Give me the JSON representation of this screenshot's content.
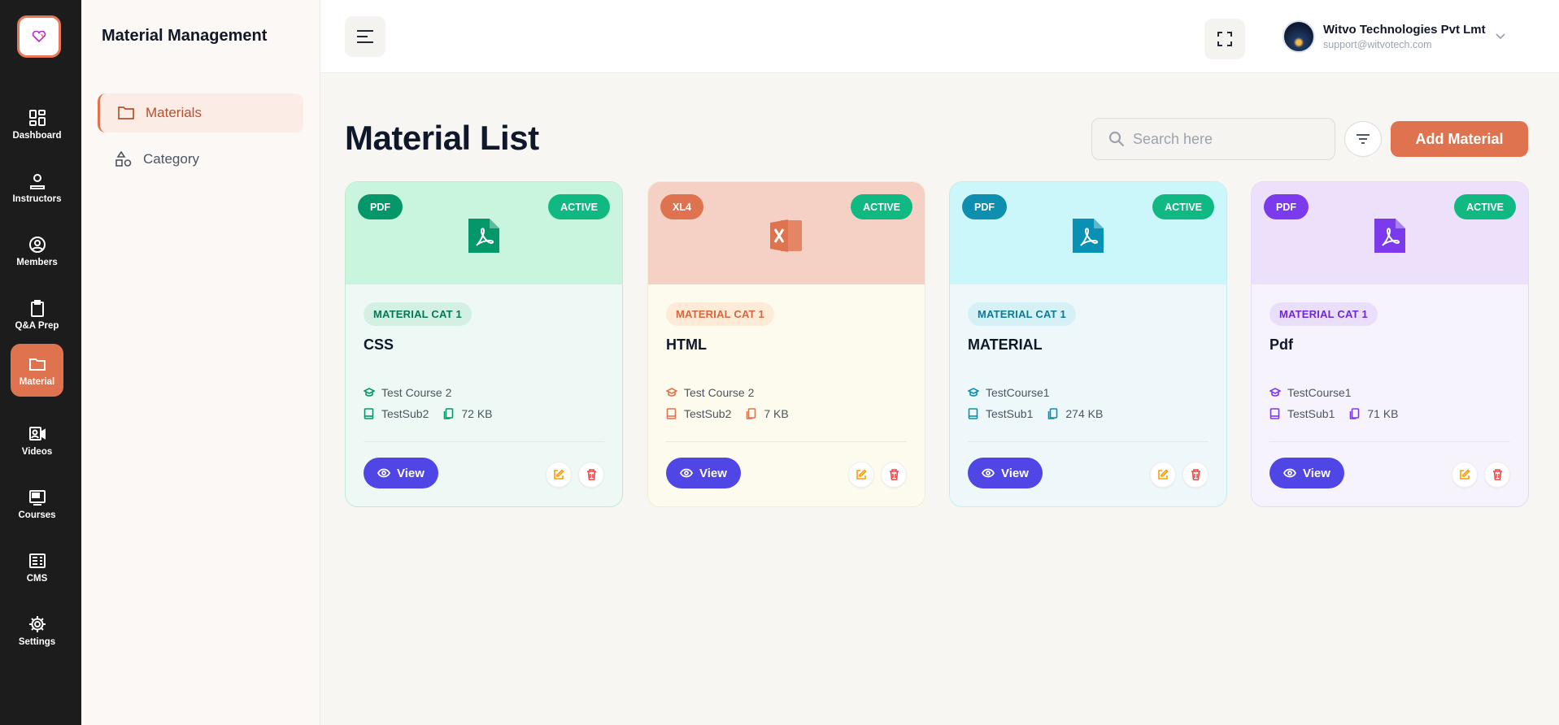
{
  "app": {
    "title": "Material Management"
  },
  "rail": [
    {
      "label": "Dashboard",
      "icon": "dashboard-icon",
      "active": false
    },
    {
      "label": "Instructors",
      "icon": "instructor-icon",
      "active": false
    },
    {
      "label": "Members",
      "icon": "members-icon",
      "active": false
    },
    {
      "label": "Q&A Prep",
      "icon": "clipboard-icon",
      "active": false
    },
    {
      "label": "Material",
      "icon": "folder-icon",
      "active": true
    },
    {
      "label": "Videos",
      "icon": "video-icon",
      "active": false
    },
    {
      "label": "Courses",
      "icon": "courses-icon",
      "active": false
    },
    {
      "label": "CMS",
      "icon": "cms-icon",
      "active": false
    },
    {
      "label": "Settings",
      "icon": "gear-icon",
      "active": false
    }
  ],
  "sidebar": {
    "items": [
      {
        "label": "Materials",
        "icon": "folder-icon",
        "active": true
      },
      {
        "label": "Category",
        "icon": "shapes-icon",
        "active": false
      }
    ]
  },
  "header": {
    "user_name": "Witvo Technologies Pvt Lmt",
    "user_email": "support@witvotech.com"
  },
  "main": {
    "title": "Material List",
    "search_placeholder": "Search here",
    "add_label": "Add Material"
  },
  "cards": [
    {
      "type": "PDF",
      "status": "ACTIVE",
      "category": "MATERIAL CAT 1",
      "title": "CSS",
      "course": "Test Course 2",
      "subject": "TestSub2",
      "size": "72 KB",
      "view_label": "View",
      "theme": {
        "head": "#c9f5df",
        "body": "#eef9f5",
        "border": "#bfe9d5",
        "accent": "#059669",
        "badge": "#059669",
        "cat_bg": "#d3f0e3",
        "cat_text": "#047857"
      }
    },
    {
      "type": "XL4",
      "status": "ACTIVE",
      "category": "MATERIAL CAT 1",
      "title": "HTML",
      "course": "Test Course 2",
      "subject": "TestSub2",
      "size": "7 KB",
      "view_label": "View",
      "theme": {
        "head": "#f5d0c4",
        "body": "#fdfbee",
        "border": "#f7ecd2",
        "accent": "#e0734f",
        "badge": "#e0734f",
        "cat_bg": "#fdebd8",
        "cat_text": "#d9653f"
      }
    },
    {
      "type": "PDF",
      "status": "ACTIVE",
      "category": "MATERIAL CAT 1",
      "title": "MATERIAL",
      "course": "TestCourse1",
      "subject": "TestSub1",
      "size": "274 KB",
      "view_label": "View",
      "theme": {
        "head": "#cbf6fa",
        "body": "#eef8fa",
        "border": "#c6ecf2",
        "accent": "#0891b2",
        "badge": "#0e8fb0",
        "cat_bg": "#d6f1f5",
        "cat_text": "#0e7a96"
      }
    },
    {
      "type": "PDF",
      "status": "ACTIVE",
      "category": "MATERIAL CAT 1",
      "title": "Pdf",
      "course": "TestCourse1",
      "subject": "TestSub1",
      "size": "71 KB",
      "view_label": "View",
      "theme": {
        "head": "#ede0fb",
        "body": "#f7f3fd",
        "border": "#e5d8f8",
        "accent": "#7c3aed",
        "badge": "#7c3aed",
        "cat_bg": "#eadffb",
        "cat_text": "#6d28d9"
      }
    }
  ]
}
